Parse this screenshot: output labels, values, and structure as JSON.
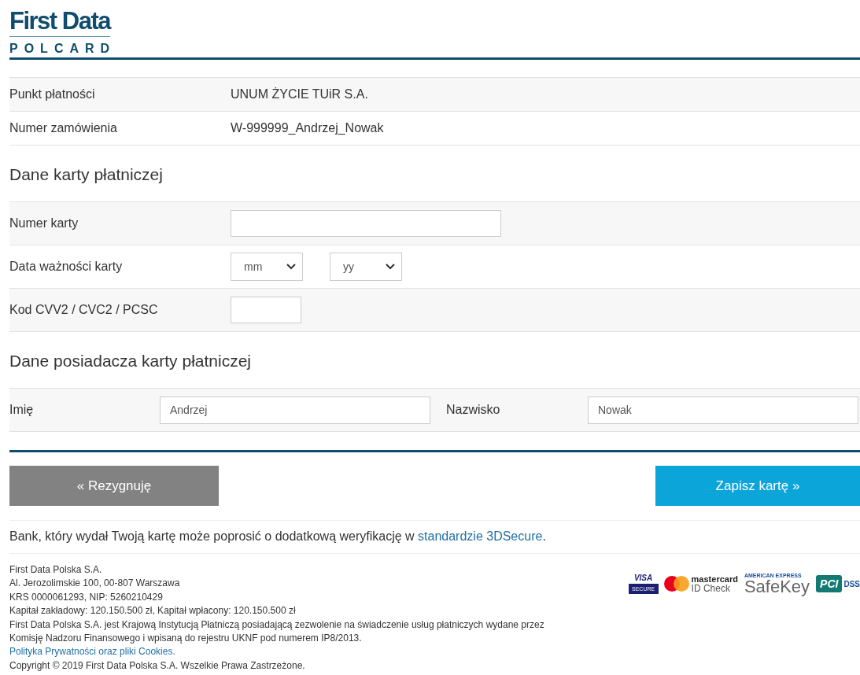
{
  "logo": {
    "brand": "First Data",
    "sub": "POLCARD"
  },
  "merchant_info": [
    {
      "label": "Punkt płatności",
      "value": "UNUM ŻYCIE TUiR S.A."
    },
    {
      "label": "Numer zamówienia",
      "value": "W-999999_Andrzej_Nowak"
    }
  ],
  "card_section": {
    "heading": "Dane karty płatniczej",
    "rows": [
      {
        "kind": "text",
        "label": "Numer karty",
        "value": ""
      },
      {
        "kind": "date",
        "label": "Data ważności karty",
        "selects": [
          "mm",
          "yy"
        ]
      },
      {
        "kind": "cvv",
        "label": "Kod CVV2 / CVC2 / PCSC",
        "value": ""
      }
    ]
  },
  "holder_section": {
    "heading": "Dane posiadacza karty płatniczej",
    "fields": [
      {
        "label": "Imię",
        "value": "Andrzej"
      },
      {
        "label": "Nazwisko",
        "value": "Nowak"
      }
    ]
  },
  "buttons": {
    "cancel": "« Rezygnuję",
    "submit": "Zapisz kartę »"
  },
  "notice": {
    "text": "Bank, który wydał Twoją kartę może poprosić o dodatkową weryfikację w",
    "link": "standardzie 3DSecure",
    "end": "."
  },
  "footer": {
    "lines": [
      "First Data Polska S.A.",
      "Al. Jerozolimskie 100, 00-807 Warszawa",
      "KRS 0000061293, NIP: 5260210429",
      "Kapitał zakładowy: 120.150.500 zł, Kapitał wpłacony: 120.150.500 zł"
    ],
    "paragraph": "First Data Polska S.A. jest Krajową Instytucją Płatniczą posiadającą zezwolenie na świadczenie usług płatniczych wydane przez Komisję Nadzoru Finansowego i wpisaną do rejestru UKNF pod numerem IP8/2013.",
    "privacy_link": "Polityka Prywatności oraz pliki Cookies.",
    "copyright": "Copyright © 2019 First Data Polska S.A. Wszelkie Prawa Zastrzeżone."
  },
  "badges": [
    {
      "kind": "visa",
      "lines": [
        "VISA",
        "SECURE"
      ]
    },
    {
      "kind": "mastercard",
      "lines": [
        "mastercard",
        "ID Check"
      ]
    },
    {
      "kind": "amex",
      "lines": [
        "AMERICAN EXPRESS",
        "SafeKey"
      ]
    },
    {
      "kind": "pci",
      "lines": [
        "PCI",
        "DSS"
      ]
    }
  ]
}
